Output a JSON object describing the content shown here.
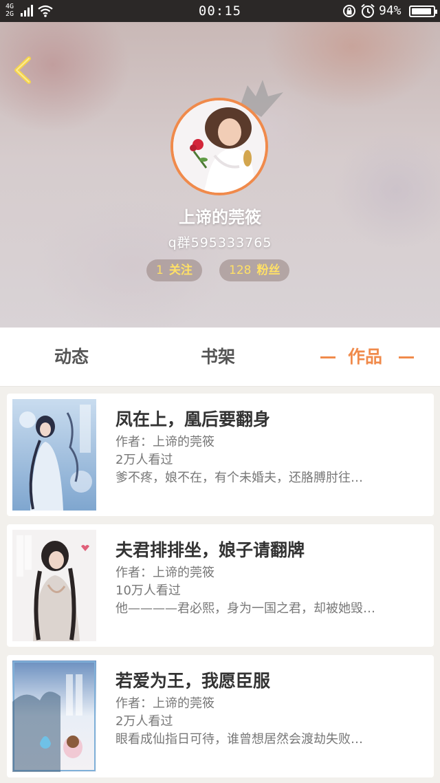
{
  "status_bar": {
    "network": [
      "4G",
      "2G"
    ],
    "time": "00:15",
    "battery": "94%",
    "battery_level": 0.94
  },
  "profile": {
    "name": "上谛的莞筱",
    "signature": "q群595333765",
    "follow_count": "1",
    "follow_label": "关注",
    "fans_count": "128",
    "fans_label": "粉丝"
  },
  "tabs": {
    "items": [
      {
        "label": "动态"
      },
      {
        "label": "书架"
      },
      {
        "label": "作品"
      }
    ],
    "active": "作品"
  },
  "colors": {
    "accent": "#f08a4b",
    "count_text": "#ffe066"
  },
  "works": [
    {
      "title": "凤在上，凰后要翻身",
      "author_label": "作者：",
      "author": "上谛的莞筱",
      "views_num": "2",
      "views_text": "万人看过",
      "desc": "爹不疼，娘不在，有个未婚夫，还胳膊肘往…"
    },
    {
      "title": "夫君排排坐，娘子请翻牌",
      "author_label": "作者：",
      "author": "上谛的莞筱",
      "views_num": "10",
      "views_text": "万人看过",
      "desc": "他————君必熙，身为一国之君，却被她毁…"
    },
    {
      "title": "若爱为王，我愿臣服",
      "author_label": "作者：",
      "author": "上谛的莞筱",
      "views_num": "2",
      "views_text": "万人看过",
      "desc": "眼看成仙指日可待，谁曾想居然会渡劫失败…"
    }
  ]
}
